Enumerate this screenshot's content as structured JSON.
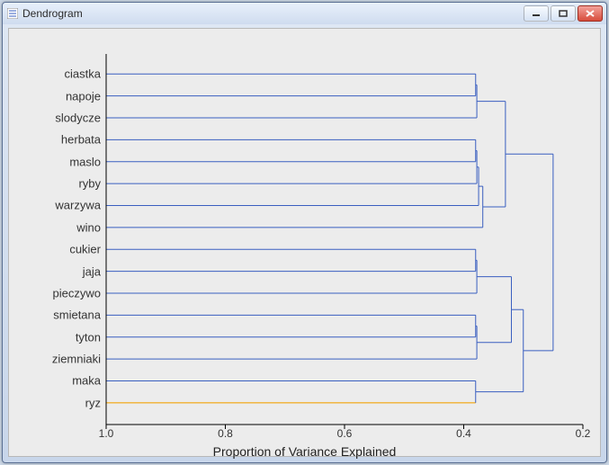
{
  "window": {
    "title": "Dendrogram"
  },
  "chart_data": {
    "type": "dendrogram",
    "xlabel": "Proportion of Variance Explained",
    "xlim": [
      1.0,
      0.2
    ],
    "xticks": [
      1.0,
      0.8,
      0.6,
      0.4,
      0.2
    ],
    "xtick_labels": [
      "1.0",
      "0.8",
      "0.6",
      "0.4",
      "0.2"
    ],
    "highlight_leaf": "ryz",
    "leaves": [
      "ciastka",
      "napoje",
      "slodycze",
      "herbata",
      "maslo",
      "ryby",
      "warzywa",
      "wino",
      "cukier",
      "jaja",
      "pieczywo",
      "smietana",
      "tyton",
      "ziemniaki",
      "maka",
      "ryz"
    ],
    "merges": [
      {
        "id": "A",
        "members": [
          "ciastka",
          "napoje"
        ],
        "height": 0.38
      },
      {
        "id": "B",
        "members": [
          "A",
          "slodycze"
        ],
        "height": 0.378
      },
      {
        "id": "C",
        "members": [
          "herbata",
          "maslo"
        ],
        "height": 0.38
      },
      {
        "id": "D",
        "members": [
          "C",
          "ryby"
        ],
        "height": 0.378
      },
      {
        "id": "E",
        "members": [
          "D",
          "warzywa"
        ],
        "height": 0.375
      },
      {
        "id": "F",
        "members": [
          "E",
          "wino"
        ],
        "height": 0.368
      },
      {
        "id": "G",
        "members": [
          "B",
          "F"
        ],
        "height": 0.33
      },
      {
        "id": "H",
        "members": [
          "cukier",
          "jaja"
        ],
        "height": 0.38
      },
      {
        "id": "I",
        "members": [
          "H",
          "pieczywo"
        ],
        "height": 0.378
      },
      {
        "id": "J",
        "members": [
          "smietana",
          "tyton"
        ],
        "height": 0.38
      },
      {
        "id": "K",
        "members": [
          "J",
          "ziemniaki"
        ],
        "height": 0.378
      },
      {
        "id": "L",
        "members": [
          "I",
          "K"
        ],
        "height": 0.32
      },
      {
        "id": "M",
        "members": [
          "maka",
          "ryz"
        ],
        "height": 0.38
      },
      {
        "id": "N",
        "members": [
          "L",
          "M"
        ],
        "height": 0.3
      },
      {
        "id": "O",
        "members": [
          "G",
          "N"
        ],
        "height": 0.25
      }
    ]
  }
}
